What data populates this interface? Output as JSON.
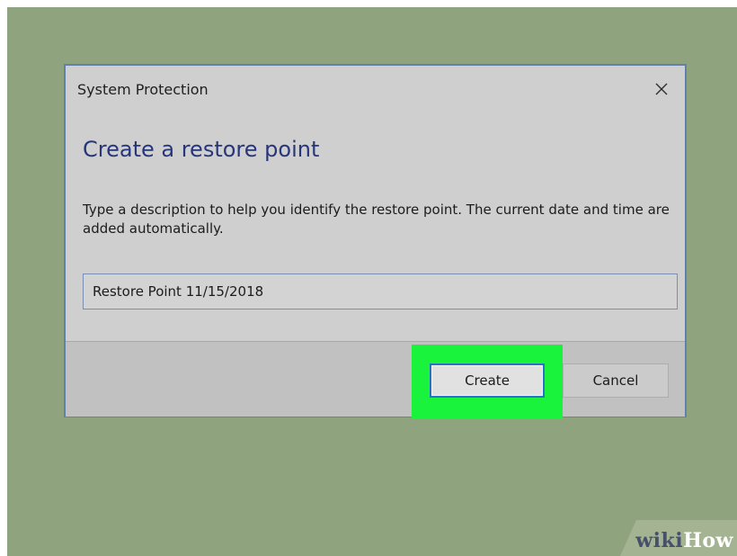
{
  "dialog": {
    "title": "System Protection",
    "heading": "Create a restore point",
    "description": "Type a description to help you identify the restore point. The current date and time are added automatically.",
    "input_value": "Restore Point 11/15/2018",
    "create_label": "Create",
    "cancel_label": "Cancel",
    "close_icon": "close-icon"
  },
  "watermark": {
    "part1": "wiki",
    "part2": "How"
  },
  "colors": {
    "background": "#8fa37e",
    "dialog_bg": "#cfcfcf",
    "heading": "#27367a",
    "highlight": "#19f33b",
    "focus_border": "#2a72c7"
  }
}
